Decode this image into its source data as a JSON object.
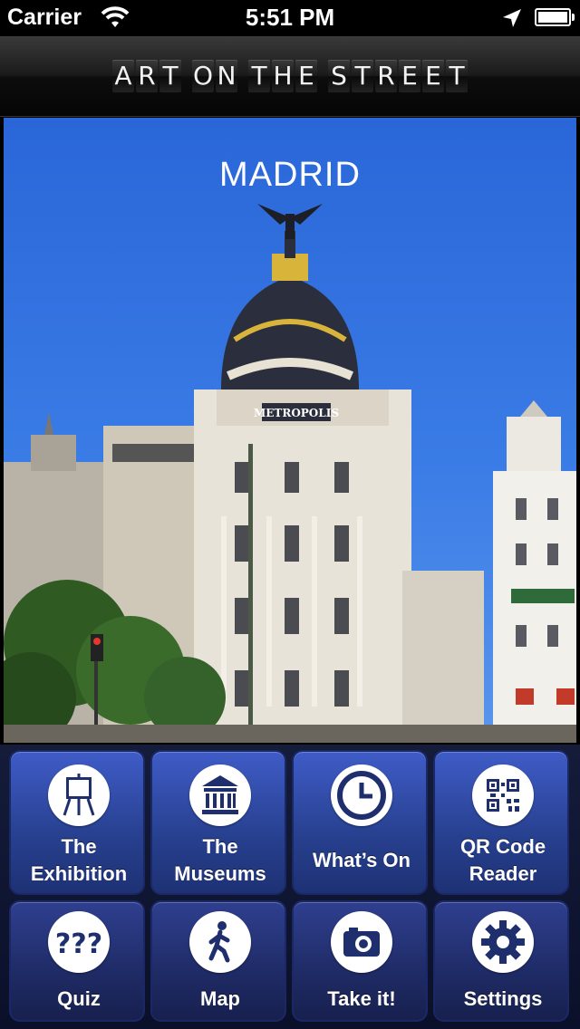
{
  "status_bar": {
    "carrier": "Carrier",
    "time": "5:51 PM"
  },
  "nav": {
    "title_words": [
      "ART",
      "ON",
      "THE",
      "STREET"
    ]
  },
  "hero": {
    "city": "MADRID",
    "building_sign": "METROPOLIS"
  },
  "menu": {
    "exhibition_line1": "The",
    "exhibition_line2": "Exhibition",
    "museums_line1": "The",
    "museums_line2": "Museums",
    "whats_on": "What’s On",
    "qr_line1": "QR Code",
    "qr_line2": "Reader",
    "quiz": "Quiz",
    "map": "Map",
    "take_it": "Take it!",
    "settings": "Settings"
  },
  "colors": {
    "button_blue": "#2f4aa8",
    "sky_blue": "#3a7ce6",
    "nav_dark": "#1b1b1b"
  },
  "icons": [
    "wifi-icon",
    "location-arrow-icon",
    "battery-icon",
    "easel-icon",
    "museum-icon",
    "clock-icon",
    "qr-code-icon",
    "question-marks-icon",
    "walking-person-icon",
    "camera-icon",
    "gear-icon"
  ]
}
